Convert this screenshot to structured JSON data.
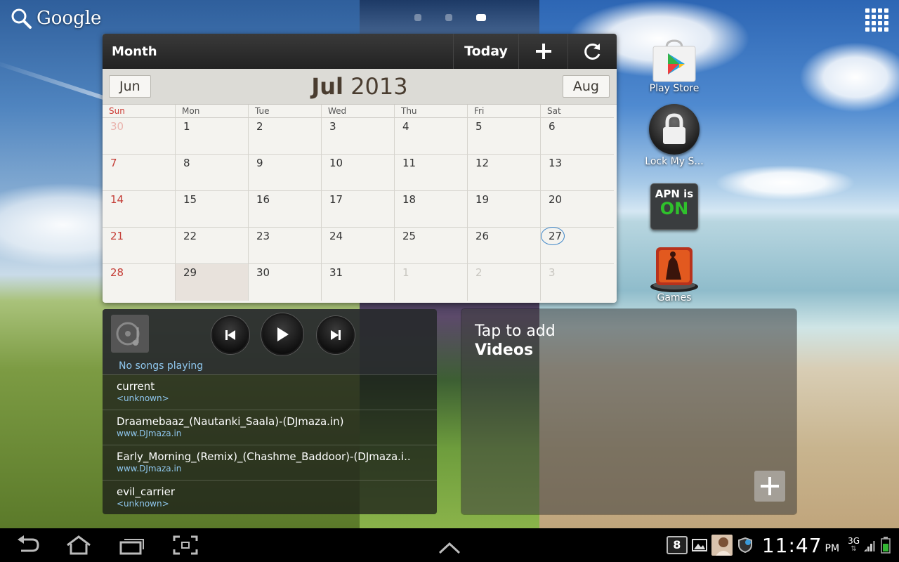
{
  "search": {
    "label": "Google"
  },
  "pager": {
    "count": 3,
    "active_index": 2
  },
  "calendar": {
    "mode_label": "Month",
    "today_label": "Today",
    "prev_month": "Jun",
    "next_month": "Aug",
    "month": "Jul",
    "year": "2013",
    "weekdays": [
      "Sun",
      "Mon",
      "Tue",
      "Wed",
      "Thu",
      "Fri",
      "Sat"
    ],
    "weeks": [
      [
        "30",
        "1",
        "2",
        "3",
        "4",
        "5",
        "6"
      ],
      [
        "7",
        "8",
        "9",
        "10",
        "11",
        "12",
        "13"
      ],
      [
        "14",
        "15",
        "16",
        "17",
        "18",
        "19",
        "20"
      ],
      [
        "21",
        "22",
        "23",
        "24",
        "25",
        "26",
        "27"
      ],
      [
        "28",
        "29",
        "30",
        "31",
        "1",
        "2",
        "3"
      ]
    ],
    "today_day": "27",
    "selected_day": "29"
  },
  "apps": [
    {
      "label": "Play Store",
      "icon": "play-store-icon"
    },
    {
      "label": "Lock My S...",
      "icon": "lock-icon"
    },
    {
      "label": "APN is",
      "icon": "apn-icon",
      "state": "ON"
    },
    {
      "label": "Games",
      "icon": "games-icon"
    }
  ],
  "music": {
    "status": "No songs playing",
    "songs": [
      {
        "title": "current",
        "subtitle": "<unknown>"
      },
      {
        "title": "Draamebaaz_(Nautanki_Saala)-(DJmaza.in)",
        "subtitle": "www.DJmaza.in"
      },
      {
        "title": "Early_Morning_(Remix)_(Chashme_Baddoor)-(DJmaza.i..",
        "subtitle": "www.DJmaza.in"
      },
      {
        "title": "evil_carrier",
        "subtitle": "<unknown>"
      }
    ]
  },
  "video": {
    "line1": "Tap to add",
    "line2": "Videos"
  },
  "statusbar": {
    "notification_count": "8",
    "time": "11:47",
    "ampm": "PM",
    "network": "3G"
  },
  "colors": {
    "accent_blue": "#8ec6ec",
    "sunday_red": "#c43c35",
    "apn_on_green": "#2fc12c"
  }
}
